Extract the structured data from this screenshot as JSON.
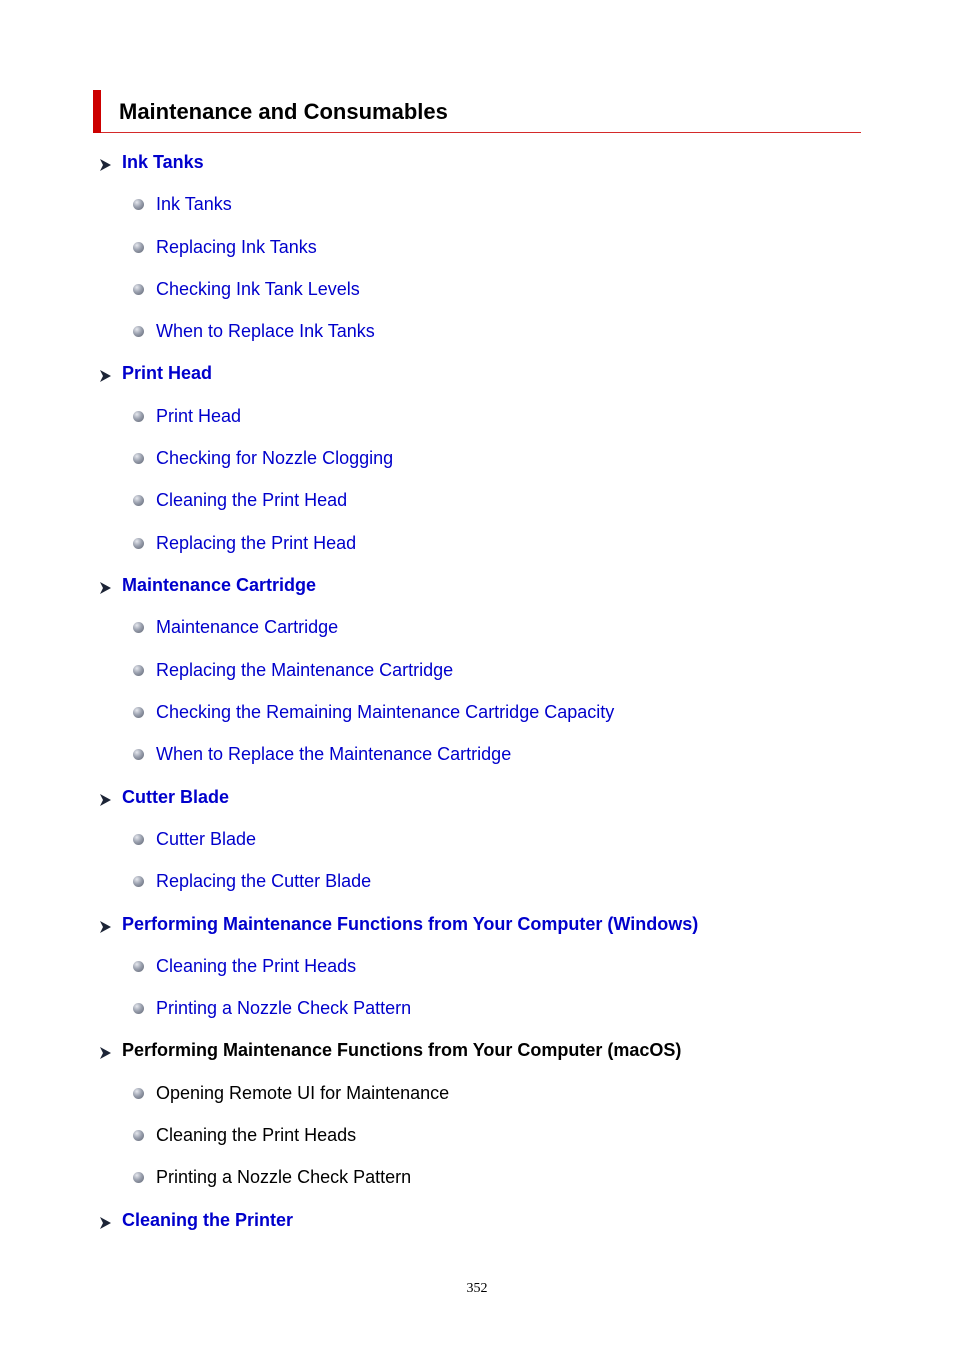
{
  "page": {
    "title": "Maintenance and Consumables",
    "page_number": "352",
    "colors": {
      "link": "#0000cc",
      "accent": "#cc0000",
      "text": "#000000"
    }
  },
  "sections": [
    {
      "label": "Ink Tanks",
      "link": true,
      "items": [
        {
          "label": "Ink Tanks",
          "link": true
        },
        {
          "label": "Replacing Ink Tanks",
          "link": true
        },
        {
          "label": "Checking Ink Tank Levels",
          "link": true
        },
        {
          "label": "When to Replace Ink Tanks",
          "link": true
        }
      ]
    },
    {
      "label": "Print Head",
      "link": true,
      "items": [
        {
          "label": "Print Head",
          "link": true
        },
        {
          "label": "Checking for Nozzle Clogging",
          "link": true
        },
        {
          "label": "Cleaning the Print Head",
          "link": true
        },
        {
          "label": "Replacing the Print Head",
          "link": true
        }
      ]
    },
    {
      "label": "Maintenance Cartridge",
      "link": true,
      "items": [
        {
          "label": "Maintenance Cartridge",
          "link": true
        },
        {
          "label": "Replacing the Maintenance Cartridge",
          "link": true
        },
        {
          "label": "Checking the Remaining Maintenance Cartridge Capacity",
          "link": true
        },
        {
          "label": "When to Replace the Maintenance Cartridge",
          "link": true
        }
      ]
    },
    {
      "label": "Cutter Blade",
      "link": true,
      "items": [
        {
          "label": "Cutter Blade",
          "link": true
        },
        {
          "label": "Replacing the Cutter Blade",
          "link": true
        }
      ]
    },
    {
      "label": "Performing Maintenance Functions from Your Computer (Windows)",
      "link": true,
      "items": [
        {
          "label": "Cleaning the Print Heads",
          "link": true
        },
        {
          "label": "Printing a Nozzle Check Pattern",
          "link": true
        }
      ]
    },
    {
      "label": "Performing Maintenance Functions from Your Computer (macOS)",
      "link": false,
      "items": [
        {
          "label": "Opening Remote UI for Maintenance",
          "link": false
        },
        {
          "label": "Cleaning the Print Heads",
          "link": false
        },
        {
          "label": "Printing a Nozzle Check Pattern",
          "link": false
        }
      ]
    },
    {
      "label": "Cleaning the Printer",
      "link": true,
      "items": []
    }
  ]
}
